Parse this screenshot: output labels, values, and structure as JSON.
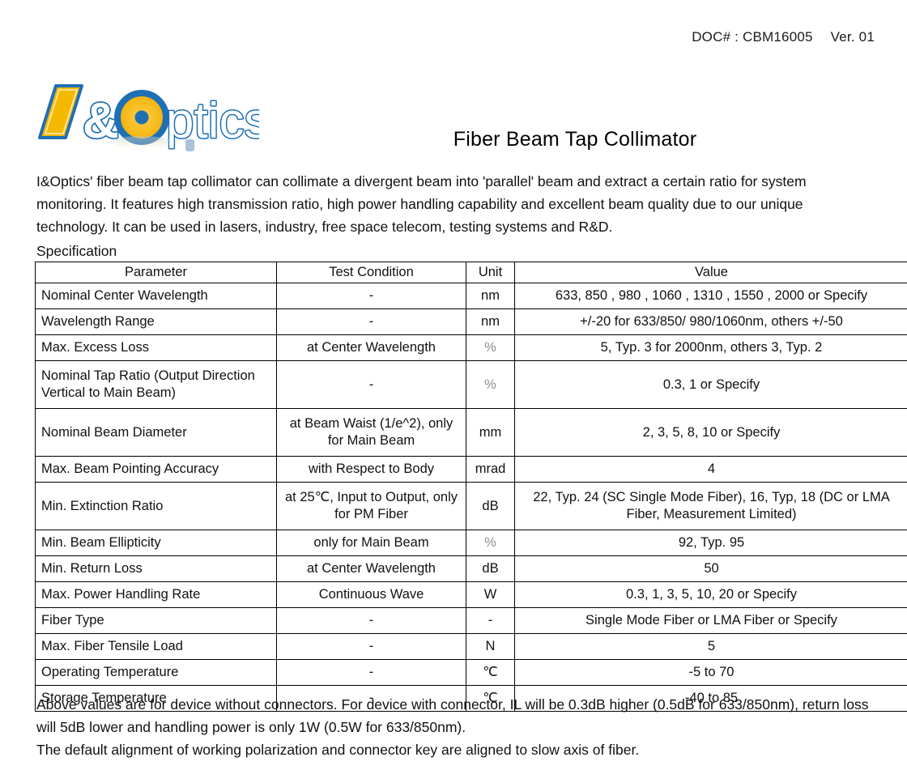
{
  "header": {
    "doc_number": "DOC# : CBM16005",
    "version": "Ver. 01"
  },
  "logo": {
    "text": "I&Optics",
    "blue": "#1f6fb5",
    "gold": "#f5b800",
    "letter_i": "I",
    "ampersand": "&",
    "letter_o": "O",
    "tail": "ptics"
  },
  "title": "Fiber Beam Tap Collimator",
  "intro": "I&Optics' fiber beam tap collimator can collimate a divergent beam into 'parallel' beam and extract a certain ratio for system monitoring. It features high transmission ratio, high power handling capability and excellent beam quality due to our unique technology. It  can be used in lasers, industry, free space telecom, testing systems and R&D.",
  "spec_label": "Specification",
  "table": {
    "columns": [
      "Parameter",
      "Test Condition",
      "Unit",
      "Value"
    ],
    "rows": [
      {
        "parameter": "Nominal Center Wavelength",
        "condition": "-",
        "unit": "nm",
        "value": "633, 850 , 980 , 1060 , 1310 , 1550 , 2000 or Specify"
      },
      {
        "parameter": "Wavelength Range",
        "condition": "-",
        "unit": "nm",
        "value": "+/-20 for 633/850/ 980/1060nm, others +/-50"
      },
      {
        "parameter": "Max. Excess Loss",
        "condition": "at Center Wavelength",
        "unit": "%",
        "value": "5, Typ. 3 for 2000nm, others 3, Typ. 2"
      },
      {
        "parameter": "Nominal Tap Ratio (Output Direction Vertical to Main Beam)",
        "condition": "-",
        "unit": "%",
        "value": "0.3, 1 or Specify"
      },
      {
        "parameter": "Nominal Beam Diameter",
        "condition": "at Beam Waist (1/e^2), only for Main Beam",
        "unit": "mm",
        "value": "2, 3, 5, 8, 10 or Specify"
      },
      {
        "parameter": "Max. Beam Pointing Accuracy",
        "condition": "with Respect to Body",
        "unit": "mrad",
        "value": "4"
      },
      {
        "parameter": "Min. Extinction Ratio",
        "condition": "at 25℃, Input to Output, only for PM Fiber",
        "unit": "dB",
        "value": "22, Typ. 24 (SC Single Mode Fiber), 16, Typ, 18 (DC or LMA Fiber, Measurement Limited)"
      },
      {
        "parameter": "Min. Beam Ellipticity",
        "condition": "only for Main Beam",
        "unit": "%",
        "value": "92, Typ. 95"
      },
      {
        "parameter": "Min. Return Loss",
        "condition": "at Center Wavelength",
        "unit": "dB",
        "value": "50"
      },
      {
        "parameter": "Max. Power Handling Rate",
        "condition": "Continuous Wave",
        "unit": "W",
        "value": "0.3, 1, 3, 5, 10, 20 or Specify"
      },
      {
        "parameter": "Fiber Type",
        "condition": "-",
        "unit": "-",
        "value": "Single Mode Fiber or LMA Fiber or Specify"
      },
      {
        "parameter": "Max. Fiber Tensile Load",
        "condition": "-",
        "unit": "N",
        "value": "5"
      },
      {
        "parameter": "Operating Temperature",
        "condition": "-",
        "unit": "℃",
        "value": "-5 to 70"
      },
      {
        "parameter": "Storage Temperature",
        "condition": "-",
        "unit": "℃",
        "value": "-40 to 85"
      }
    ]
  },
  "footnotes": [
    "Above values are for device without connectors. For device with connector, IL will be 0.3dB higher (0.5dB for 633/850nm), return loss will 5dB lower and handling power is only 1W (0.5W for 633/850nm).",
    "The default alignment of working polarization and connector key are aligned to slow axis of fiber."
  ]
}
